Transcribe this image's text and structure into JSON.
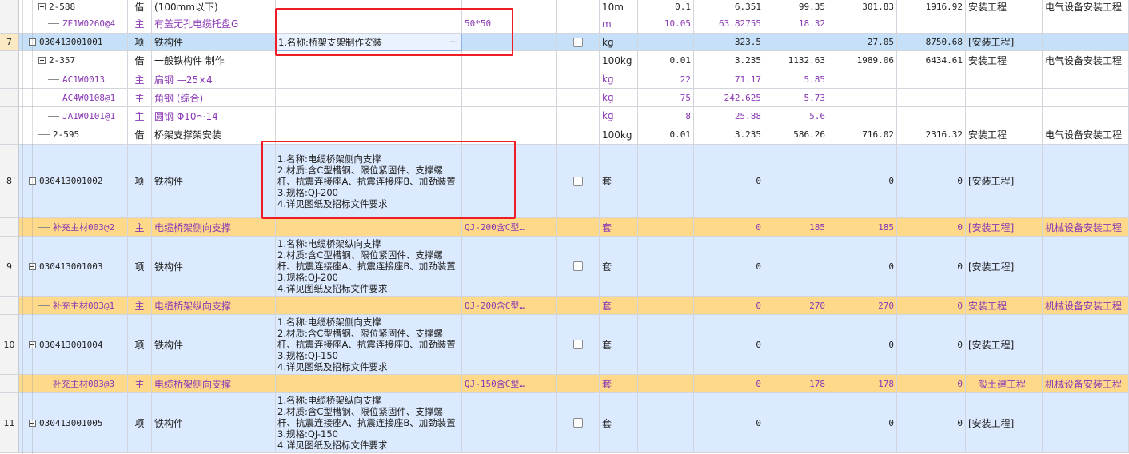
{
  "rows": [
    {
      "kind": "sub",
      "height": 18,
      "rownum": "",
      "indent": 2,
      "marker": "exp",
      "code": "2-588",
      "cat": "借",
      "name": "(100mm以下)",
      "desc": "",
      "spec": "",
      "check": false,
      "unit": "10m",
      "qty": "0.1",
      "price": "6.351",
      "c1": "99.35",
      "c2": "301.83",
      "c3": "1916.92",
      "c4": "安装工程",
      "c5": "电气设备安装工程",
      "purple": false
    },
    {
      "kind": "sub",
      "height": 24,
      "rownum": "",
      "indent": 3,
      "marker": "line",
      "code": "ZE1W0260@4",
      "cat": "主",
      "name": "有盖无孔电缆托盘G",
      "desc": "",
      "spec": "50*50",
      "check": false,
      "unit": "m",
      "qty": "10.05",
      "price": "63.82755",
      "c1": "18.32",
      "c2": "",
      "c3": "",
      "c4": "",
      "c5": "",
      "purple": true
    },
    {
      "kind": "selected",
      "height": 22,
      "rownum": "7",
      "indent": 1,
      "marker": "exp",
      "code": "030413001001",
      "cat": "项",
      "name": "铁构件",
      "desc": "1.名称:桥架支架制作安装",
      "spec": "",
      "check": true,
      "unit": "kg",
      "qty": "",
      "price": "323.5",
      "c1": "",
      "c2": "27.05",
      "c3": "8750.68",
      "c4": "[安装工程]",
      "c5": "",
      "purple": false,
      "editing": true
    },
    {
      "kind": "sub",
      "height": 24,
      "rownum": "",
      "indent": 2,
      "marker": "exp",
      "code": "2-357",
      "cat": "借",
      "name": "一般铁构件 制作",
      "desc": "",
      "spec": "",
      "check": false,
      "unit": "100kg",
      "qty": "0.01",
      "price": "3.235",
      "c1": "1132.63",
      "c2": "1989.06",
      "c3": "6434.61",
      "c4": "安装工程",
      "c5": "电气设备安装工程",
      "purple": false
    },
    {
      "kind": "sub",
      "height": 23,
      "rownum": "",
      "indent": 3,
      "marker": "line",
      "code": "AC1W0013",
      "cat": "主",
      "name": "扁钢 —25×4",
      "desc": "",
      "spec": "",
      "check": false,
      "unit": "kg",
      "qty": "22",
      "price": "71.17",
      "c1": "5.85",
      "c2": "",
      "c3": "",
      "c4": "",
      "c5": "",
      "purple": true
    },
    {
      "kind": "sub",
      "height": 23,
      "rownum": "",
      "indent": 3,
      "marker": "line",
      "code": "AC4W0108@1",
      "cat": "主",
      "name": "角钢 (综合)",
      "desc": "",
      "spec": "",
      "check": false,
      "unit": "kg",
      "qty": "75",
      "price": "242.625",
      "c1": "5.73",
      "c2": "",
      "c3": "",
      "c4": "",
      "c5": "",
      "purple": true
    },
    {
      "kind": "sub",
      "height": 23,
      "rownum": "",
      "indent": 3,
      "marker": "line",
      "code": "JA1W0101@1",
      "cat": "主",
      "name": "圆钢 Φ10～14",
      "desc": "",
      "spec": "",
      "check": false,
      "unit": "kg",
      "qty": "8",
      "price": "25.88",
      "c1": "5.6",
      "c2": "",
      "c3": "",
      "c4": "",
      "c5": "",
      "purple": true
    },
    {
      "kind": "sub",
      "height": 24,
      "rownum": "",
      "indent": 2,
      "marker": "line",
      "code": "2-595",
      "cat": "借",
      "name": "桥架支撑架安装",
      "desc": "",
      "spec": "",
      "check": false,
      "unit": "100kg",
      "qty": "0.01",
      "price": "3.235",
      "c1": "586.26",
      "c2": "716.02",
      "c3": "2316.32",
      "c4": "安装工程",
      "c5": "电气设备安装工程",
      "purple": false
    },
    {
      "kind": "item",
      "height": 92,
      "rownum": "8",
      "indent": 1,
      "marker": "exp",
      "code": "030413001002",
      "cat": "项",
      "name": "铁构件",
      "desc": "1.名称:电缆桥架侧向支撑\n2.材质:含C型槽钢、限位紧固件、支撑螺杆、抗震连接座A、抗震连接座B、加劲装置\n3.规格:QJ-200\n4.详见图纸及招标文件要求",
      "spec": "",
      "check": true,
      "unit": "套",
      "qty": "",
      "price": "0",
      "c1": "",
      "c2": "0",
      "c3": "0",
      "c4": "[安装工程]",
      "c5": "",
      "purple": false
    },
    {
      "kind": "mat",
      "height": 23,
      "rownum": "",
      "indent": 2,
      "marker": "line",
      "code": "补充主材003@2",
      "cat": "主",
      "name": "电缆桥架侧向支撑",
      "desc": "",
      "spec": "QJ-200含C型…",
      "check": false,
      "unit": "套",
      "qty": "",
      "price": "0",
      "c1": "185",
      "c2": "185",
      "c3": "0",
      "c4": "[安装工程]",
      "c5": "机械设备安装工程",
      "purple": true
    },
    {
      "kind": "item",
      "height": 75,
      "rownum": "9",
      "indent": 1,
      "marker": "exp",
      "code": "030413001003",
      "cat": "项",
      "name": "铁构件",
      "desc": "1.名称:电缆桥架纵向支撑\n2.材质:含C型槽钢、限位紧固件、支撑螺杆、抗震连接座A、抗震连接座B、加劲装置\n3.规格:QJ-200\n4.详见图纸及招标文件要求",
      "spec": "",
      "check": true,
      "unit": "套",
      "qty": "",
      "price": "0",
      "c1": "",
      "c2": "0",
      "c3": "0",
      "c4": "[安装工程]",
      "c5": "",
      "purple": false
    },
    {
      "kind": "mat",
      "height": 23,
      "rownum": "",
      "indent": 2,
      "marker": "line",
      "code": "补充主材003@1",
      "cat": "主",
      "name": "电缆桥架纵向支撑",
      "desc": "",
      "spec": "QJ-200含C型…",
      "check": false,
      "unit": "套",
      "qty": "",
      "price": "0",
      "c1": "270",
      "c2": "270",
      "c3": "0",
      "c4": "安装工程",
      "c5": "机械设备安装工程",
      "purple": true
    },
    {
      "kind": "item",
      "height": 75,
      "rownum": "10",
      "indent": 1,
      "marker": "exp",
      "code": "030413001004",
      "cat": "项",
      "name": "铁构件",
      "desc": "1.名称:电缆桥架侧向支撑\n2.材质:含C型槽钢、限位紧固件、支撑螺杆、抗震连接座A、抗震连接座B、加劲装置\n3.规格:QJ-150\n4.详见图纸及招标文件要求",
      "spec": "",
      "check": true,
      "unit": "套",
      "qty": "",
      "price": "0",
      "c1": "",
      "c2": "0",
      "c3": "0",
      "c4": "[安装工程]",
      "c5": "",
      "purple": false
    },
    {
      "kind": "mat",
      "height": 23,
      "rownum": "",
      "indent": 2,
      "marker": "line",
      "code": "补充主材003@3",
      "cat": "主",
      "name": "电缆桥架侧向支撑",
      "desc": "",
      "spec": "QJ-150含C型…",
      "check": false,
      "unit": "套",
      "qty": "",
      "price": "0",
      "c1": "178",
      "c2": "178",
      "c3": "0",
      "c4": "一般土建工程",
      "c5": "机械设备安装工程",
      "purple": true
    },
    {
      "kind": "item",
      "height": 75,
      "rownum": "11",
      "indent": 1,
      "marker": "exp",
      "code": "030413001005",
      "cat": "项",
      "name": "铁构件",
      "desc": "1.名称:电缆桥架纵向支撑\n2.材质:含C型槽钢、限位紧固件、支撑螺杆、抗震连接座A、抗震连接座B、加劲装置\n3.规格:QJ-150\n4.详见图纸及招标文件要求",
      "spec": "",
      "check": true,
      "unit": "套",
      "qty": "",
      "price": "0",
      "c1": "",
      "c2": "0",
      "c3": "0",
      "c4": "[安装工程]",
      "c5": "",
      "purple": false
    }
  ],
  "ui": {
    "edit_button_label": "···"
  },
  "colors": {
    "highlight_box": "#ee1c25",
    "selected_row": "#c5e0f8",
    "item_row": "#dceaff",
    "material_row": "#ffd98a",
    "material_text": "#8a38b4"
  }
}
